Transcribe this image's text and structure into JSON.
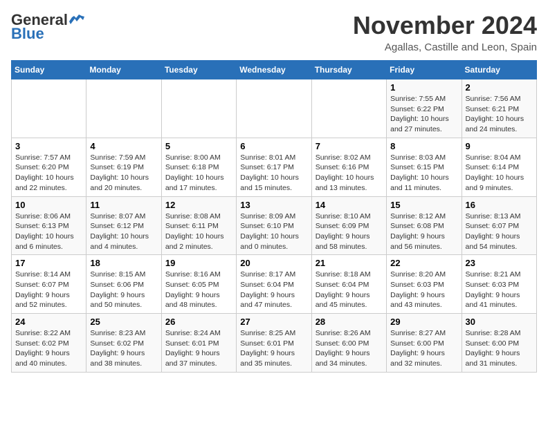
{
  "header": {
    "logo_line1": "General",
    "logo_line2": "Blue",
    "month": "November 2024",
    "location": "Agallas, Castille and Leon, Spain"
  },
  "weekdays": [
    "Sunday",
    "Monday",
    "Tuesday",
    "Wednesday",
    "Thursday",
    "Friday",
    "Saturday"
  ],
  "weeks": [
    [
      {
        "day": "",
        "info": ""
      },
      {
        "day": "",
        "info": ""
      },
      {
        "day": "",
        "info": ""
      },
      {
        "day": "",
        "info": ""
      },
      {
        "day": "",
        "info": ""
      },
      {
        "day": "1",
        "info": "Sunrise: 7:55 AM\nSunset: 6:22 PM\nDaylight: 10 hours and 27 minutes."
      },
      {
        "day": "2",
        "info": "Sunrise: 7:56 AM\nSunset: 6:21 PM\nDaylight: 10 hours and 24 minutes."
      }
    ],
    [
      {
        "day": "3",
        "info": "Sunrise: 7:57 AM\nSunset: 6:20 PM\nDaylight: 10 hours and 22 minutes."
      },
      {
        "day": "4",
        "info": "Sunrise: 7:59 AM\nSunset: 6:19 PM\nDaylight: 10 hours and 20 minutes."
      },
      {
        "day": "5",
        "info": "Sunrise: 8:00 AM\nSunset: 6:18 PM\nDaylight: 10 hours and 17 minutes."
      },
      {
        "day": "6",
        "info": "Sunrise: 8:01 AM\nSunset: 6:17 PM\nDaylight: 10 hours and 15 minutes."
      },
      {
        "day": "7",
        "info": "Sunrise: 8:02 AM\nSunset: 6:16 PM\nDaylight: 10 hours and 13 minutes."
      },
      {
        "day": "8",
        "info": "Sunrise: 8:03 AM\nSunset: 6:15 PM\nDaylight: 10 hours and 11 minutes."
      },
      {
        "day": "9",
        "info": "Sunrise: 8:04 AM\nSunset: 6:14 PM\nDaylight: 10 hours and 9 minutes."
      }
    ],
    [
      {
        "day": "10",
        "info": "Sunrise: 8:06 AM\nSunset: 6:13 PM\nDaylight: 10 hours and 6 minutes."
      },
      {
        "day": "11",
        "info": "Sunrise: 8:07 AM\nSunset: 6:12 PM\nDaylight: 10 hours and 4 minutes."
      },
      {
        "day": "12",
        "info": "Sunrise: 8:08 AM\nSunset: 6:11 PM\nDaylight: 10 hours and 2 minutes."
      },
      {
        "day": "13",
        "info": "Sunrise: 8:09 AM\nSunset: 6:10 PM\nDaylight: 10 hours and 0 minutes."
      },
      {
        "day": "14",
        "info": "Sunrise: 8:10 AM\nSunset: 6:09 PM\nDaylight: 9 hours and 58 minutes."
      },
      {
        "day": "15",
        "info": "Sunrise: 8:12 AM\nSunset: 6:08 PM\nDaylight: 9 hours and 56 minutes."
      },
      {
        "day": "16",
        "info": "Sunrise: 8:13 AM\nSunset: 6:07 PM\nDaylight: 9 hours and 54 minutes."
      }
    ],
    [
      {
        "day": "17",
        "info": "Sunrise: 8:14 AM\nSunset: 6:07 PM\nDaylight: 9 hours and 52 minutes."
      },
      {
        "day": "18",
        "info": "Sunrise: 8:15 AM\nSunset: 6:06 PM\nDaylight: 9 hours and 50 minutes."
      },
      {
        "day": "19",
        "info": "Sunrise: 8:16 AM\nSunset: 6:05 PM\nDaylight: 9 hours and 48 minutes."
      },
      {
        "day": "20",
        "info": "Sunrise: 8:17 AM\nSunset: 6:04 PM\nDaylight: 9 hours and 47 minutes."
      },
      {
        "day": "21",
        "info": "Sunrise: 8:18 AM\nSunset: 6:04 PM\nDaylight: 9 hours and 45 minutes."
      },
      {
        "day": "22",
        "info": "Sunrise: 8:20 AM\nSunset: 6:03 PM\nDaylight: 9 hours and 43 minutes."
      },
      {
        "day": "23",
        "info": "Sunrise: 8:21 AM\nSunset: 6:03 PM\nDaylight: 9 hours and 41 minutes."
      }
    ],
    [
      {
        "day": "24",
        "info": "Sunrise: 8:22 AM\nSunset: 6:02 PM\nDaylight: 9 hours and 40 minutes."
      },
      {
        "day": "25",
        "info": "Sunrise: 8:23 AM\nSunset: 6:02 PM\nDaylight: 9 hours and 38 minutes."
      },
      {
        "day": "26",
        "info": "Sunrise: 8:24 AM\nSunset: 6:01 PM\nDaylight: 9 hours and 37 minutes."
      },
      {
        "day": "27",
        "info": "Sunrise: 8:25 AM\nSunset: 6:01 PM\nDaylight: 9 hours and 35 minutes."
      },
      {
        "day": "28",
        "info": "Sunrise: 8:26 AM\nSunset: 6:00 PM\nDaylight: 9 hours and 34 minutes."
      },
      {
        "day": "29",
        "info": "Sunrise: 8:27 AM\nSunset: 6:00 PM\nDaylight: 9 hours and 32 minutes."
      },
      {
        "day": "30",
        "info": "Sunrise: 8:28 AM\nSunset: 6:00 PM\nDaylight: 9 hours and 31 minutes."
      }
    ]
  ]
}
